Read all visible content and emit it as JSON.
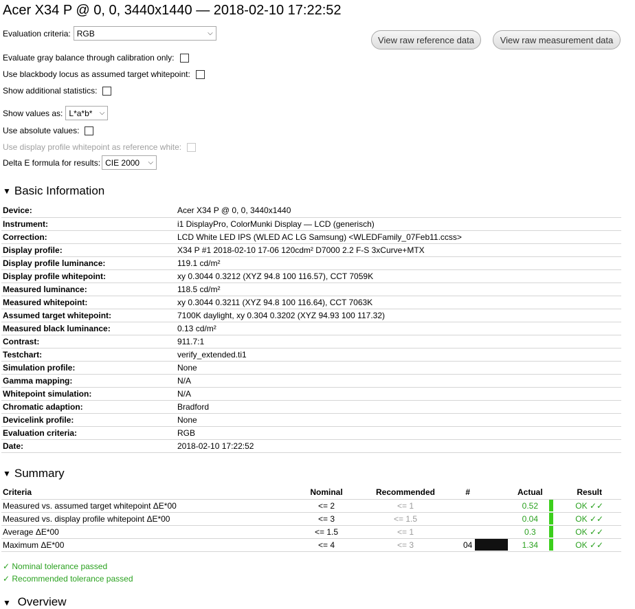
{
  "page": {
    "title": "Acer X34 P @ 0, 0, 3440x1440 — 2018-02-10 17:22:52"
  },
  "options": {
    "evaluation_criteria_label": "Evaluation criteria:",
    "evaluation_criteria_value": "RGB",
    "gray_balance_label": "Evaluate gray balance through calibration only:",
    "blackbody_label": "Use blackbody locus as assumed target whitepoint:",
    "additional_stats_label": "Show additional statistics:",
    "show_values_label": "Show values as:",
    "show_values_value": "L*a*b*",
    "absolute_values_label": "Use absolute values:",
    "display_profile_white_label": "Use display profile whitepoint as reference white:",
    "delta_e_label": "Delta E formula for results:",
    "delta_e_value": "CIE 2000"
  },
  "buttons": {
    "raw_reference": "View raw reference data",
    "raw_measurement": "View raw measurement data"
  },
  "basic_info": {
    "heading": "Basic Information",
    "rows": [
      {
        "key": "Device:",
        "value": "Acer X34 P @ 0, 0, 3440x1440"
      },
      {
        "key": "Instrument:",
        "value": "i1 DisplayPro, ColorMunki Display — LCD (generisch)"
      },
      {
        "key": "Correction:",
        "value": "LCD White LED IPS (WLED AC LG Samsung) <WLEDFamily_07Feb11.ccss>"
      },
      {
        "key": "Display profile:",
        "value": "X34 P #1 2018-02-10 17-06 120cdm² D7000 2.2 F-S 3xCurve+MTX"
      },
      {
        "key": "Display profile luminance:",
        "value": "119.1 cd/m²"
      },
      {
        "key": "Display profile whitepoint:",
        "value": "xy 0.3044 0.3212 (XYZ 94.8 100 116.57), CCT 7059K"
      },
      {
        "key": "Measured luminance:",
        "value": "118.5 cd/m²"
      },
      {
        "key": "Measured whitepoint:",
        "value": "xy 0.3044 0.3211 (XYZ 94.8 100 116.64), CCT 7063K"
      },
      {
        "key": "Assumed target whitepoint:",
        "value": "7100K daylight, xy 0.304 0.3202 (XYZ 94.93 100 117.32)"
      },
      {
        "key": "Measured black luminance:",
        "value": "0.13 cd/m²"
      },
      {
        "key": "Contrast:",
        "value": "911.7:1"
      },
      {
        "key": "Testchart:",
        "value": "verify_extended.ti1"
      },
      {
        "key": "Simulation profile:",
        "value": "None"
      },
      {
        "key": "Gamma mapping:",
        "value": "N/A"
      },
      {
        "key": "Whitepoint simulation:",
        "value": "N/A"
      },
      {
        "key": "Chromatic adaption:",
        "value": "Bradford"
      },
      {
        "key": "Devicelink profile:",
        "value": "None"
      },
      {
        "key": "Evaluation criteria:",
        "value": "RGB"
      },
      {
        "key": "Date:",
        "value": "2018-02-10 17:22:52"
      }
    ]
  },
  "summary": {
    "heading": "Summary",
    "headers": {
      "criteria": "Criteria",
      "nominal": "Nominal",
      "recommended": "Recommended",
      "num": "#",
      "actual": "Actual",
      "result": "Result"
    },
    "rows": [
      {
        "criteria": "Measured vs. assumed target whitepoint ΔE*00",
        "nominal": "<= 2",
        "recommended": "<= 1",
        "num": "",
        "actual": "0.52",
        "result": "OK ✓✓"
      },
      {
        "criteria": "Measured vs. display profile whitepoint ΔE*00",
        "nominal": "<= 3",
        "recommended": "<= 1.5",
        "num": "",
        "actual": "0.04",
        "result": "OK ✓✓"
      },
      {
        "criteria": "Average ΔE*00",
        "nominal": "<= 1.5",
        "recommended": "<= 1",
        "num": "",
        "actual": "0.3",
        "result": "OK ✓✓"
      },
      {
        "criteria": "Maximum ΔE*00",
        "nominal": "<= 4",
        "recommended": "<= 3",
        "num": "04",
        "actual": "1.34",
        "result": "OK ✓✓"
      }
    ],
    "nominal_passed": "✓ Nominal tolerance passed",
    "recommended_passed": "✓ Recommended tolerance passed"
  },
  "overview": {
    "heading_partial": "Overview"
  },
  "colors": {
    "ok_green": "#2aa11f",
    "bar_green": "#3ccf1c"
  }
}
